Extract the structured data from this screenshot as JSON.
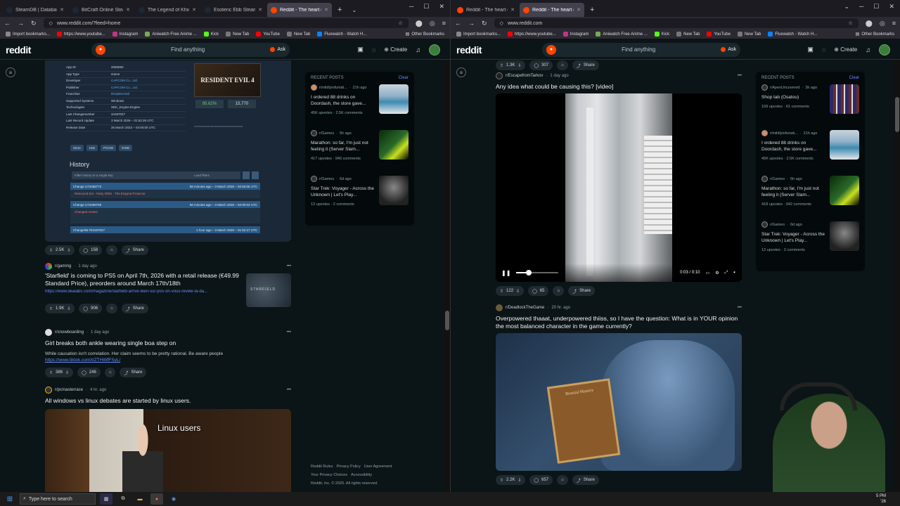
{
  "left": {
    "tabs": [
      {
        "label": "SteamDB | Database of e",
        "color": "#1b2838",
        "active": false
      },
      {
        "label": "BitCraft Online Steam Ch",
        "color": "#1b2838",
        "active": false
      },
      {
        "label": "The Legend of Khiimori",
        "color": "#1b2838",
        "active": false
      },
      {
        "label": "Esoteric Ebb Steam Char",
        "color": "#1b2838",
        "active": false
      },
      {
        "label": "Reddit - The heart of th",
        "color": "#ff4500",
        "active": true
      }
    ],
    "url": "www.reddit.com/?feed=home",
    "bookmarks": [
      "Import bookmarks...",
      "https://www.youtube...",
      "Instagram",
      "Aniwatch Free Anime ...",
      "Kick",
      "New Tab",
      "YouTube",
      "New Tab",
      "Fluxwatch - Watch H..."
    ],
    "bookmarks_other": "Other Bookmarks",
    "header": {
      "logo": "reddit",
      "search_placeholder": "Find anything",
      "ask": "Ask",
      "create": "Create"
    },
    "steamdb": {
      "rows": [
        [
          "App ID",
          "2050650"
        ],
        [
          "App Type",
          "Game"
        ],
        [
          "Developer",
          "CAPCOM Co., Ltd."
        ],
        [
          "Publisher",
          "CAPCOM Co., Ltd."
        ],
        [
          "Franchise",
          "Resident Evil"
        ],
        [
          "Supported Systems",
          "Windows"
        ],
        [
          "Technologies",
          "SDK_Engine.Engine"
        ],
        [
          "Last Changenumber",
          "34187027"
        ],
        [
          "Last Record Update",
          "3 March 2026 – 01:52:26 UTC"
        ],
        [
          "Release Date",
          "26 March 2023 – 04:00:00 UTC"
        ]
      ],
      "game_logo": "RESIDENT EVIL 4",
      "rating": "95.62%",
      "players": "15,770",
      "filters": [
        "Store",
        "Hub",
        "PCGW",
        "IGDB"
      ],
      "history_title": "History",
      "history_filter": "Filter history to a single key",
      "history_load": "Load filters",
      "changes": [
        {
          "id": "Change U73468773",
          "time": "58 minutes ago – 3 March 2026 – 02:50:05 UTC",
          "detail": "Removed Ext - Party DRM · The Enigma Protector"
        },
        {
          "id": "Change U73468766",
          "time": "58 minutes ago – 3 March 2026 – 02:00:03 UTC",
          "detail": "Changed Assets"
        },
        {
          "id": "Changelist #34187027",
          "time": "1 hour ago – 3 March 2026 – 01:52:27 UTC",
          "detail": ""
        }
      ]
    },
    "post0_actions": {
      "votes": "2.5K",
      "comments": "158",
      "share": "Share"
    },
    "posts": [
      {
        "sub": "r/gaming",
        "age": "1 day ago",
        "title": "'Starfield' is coming to PS5 on April 7th, 2026 with a retail release (€49.99 Standard Price), preorders around March 17th/18th",
        "link": "https://www.dealabs.com/magazine/starfield-arrive-bien-sur-ps5-on-vous-revele-la-da...",
        "votes": "1.9K",
        "comments": "906",
        "share": "Share",
        "thumb_text": "STARFIELD"
      },
      {
        "sub": "r/snowboarding",
        "age": "1 day ago",
        "title": "Girl breaks both ankle wearing single boa step on",
        "body": "While causation isn't correlation. Her claim seems to be pretty rational. Be aware people ",
        "body_link": "https://www.tiktok.com/t/ZTHWfFSyL/",
        "votes": "386",
        "comments": "246",
        "share": "Share"
      },
      {
        "sub": "r/pcmasterrace",
        "age": "4 hr. ago",
        "title": "All windows vs linux debates are started by linux users.",
        "image_caption": "Linux users"
      }
    ],
    "recent": {
      "heading": "RECENT POSTS",
      "clear": "Clear",
      "items": [
        {
          "sub": "r/mildlyinfuriati...",
          "age": "21h ago",
          "title": "I ordered 88 drinks on Doordash, the store gave...",
          "stats": "45K upvotes · 2.5K comments",
          "img": "drinks"
        },
        {
          "sub": "r/Games",
          "age": "5h ago",
          "title": "Marathon: so far, I'm just not feeling it (Server Slam...",
          "stats": "417 upvotes · 940 comments",
          "img": "marathon"
        },
        {
          "sub": "r/Games",
          "age": "6d ago",
          "title": "Star Trek: Voyager - Across the Unknown | Let's Play...",
          "stats": "13 upvotes · 2 comments",
          "img": "voyager"
        }
      ]
    },
    "footer": [
      "Reddit Rules",
      "Privacy Policy",
      "User Agreement",
      "Your Privacy Choices",
      "Accessibility",
      "Reddit, Inc. © 2026. All rights reserved."
    ]
  },
  "right": {
    "tabs": [
      {
        "label": "Reddit - The heart of the intern",
        "color": "#ff4500",
        "active": false
      },
      {
        "label": "Reddit - The heart of the interne",
        "color": "#ff4500",
        "active": true
      }
    ],
    "url": "www.reddit.com",
    "bookmarks": [
      "Import bookmarks...",
      "https://www.youtube...",
      "Instagram",
      "Aniwatch Free Anime ...",
      "Kick",
      "New Tab",
      "YouTube",
      "New Tab",
      "Fluxwatch - Watch H..."
    ],
    "bookmarks_other": "Other Bookmarks",
    "header": {
      "logo": "reddit",
      "search_placeholder": "Find anything",
      "ask": "Ask",
      "create": "Create"
    },
    "top_actions": {
      "votes": "1.3K",
      "comments": "307",
      "share": "Share"
    },
    "posts": [
      {
        "sub": "r/EscapefromTarkov",
        "age": "1 day ago",
        "title": "Any idea what could be causing this? [video]",
        "video_time": "0:03 / 0:10",
        "video_progress": 0.3,
        "votes": "122",
        "comments": "65",
        "share": "Share"
      },
      {
        "sub": "r/DeadlockTheGame",
        "age": "20 hr. ago",
        "title": "Overpowered thaaat, underpowered thiiss, so I have the question: What is in YOUR opinion the most balanced character in the game currently?",
        "votes": "2.2K",
        "comments": "657",
        "share": "Share",
        "book_text": "Beastial Mastery"
      }
    ],
    "recent": {
      "heading": "RECENT POSTS",
      "clear": "Clear",
      "items": [
        {
          "sub": "r/ApexUncovered",
          "age": "3h ago",
          "title": "Shop tab (Osatou)",
          "stats": "109 upvotes · 61 comments",
          "img": "apex"
        },
        {
          "sub": "r/mildlyinfuriati...",
          "age": "21h ago",
          "title": "I ordered 88 drinks on Doordash, the store gave...",
          "stats": "45K upvotes · 2.5K comments",
          "img": "drinks"
        },
        {
          "sub": "r/Games",
          "age": "5h ago",
          "title": "Marathon: so far, I'm just not feeling it (Server Slam...",
          "stats": "418 upvotes · 942 comments",
          "img": "marathon"
        },
        {
          "sub": "r/Games",
          "age": "6d ago",
          "title": "Star Trek: Voyager - Across the Unknown | Let's Play...",
          "stats": "13 upvotes · 2 comments",
          "img": "voyager"
        }
      ]
    }
  },
  "taskbar": {
    "search_placeholder": "Type here to search",
    "time": "5 PM",
    "date": "'26"
  },
  "icons": {
    "upvote": "▲",
    "downvote": "▼",
    "comment": "comment-icon",
    "share": "share-icon",
    "award": "award-icon"
  }
}
